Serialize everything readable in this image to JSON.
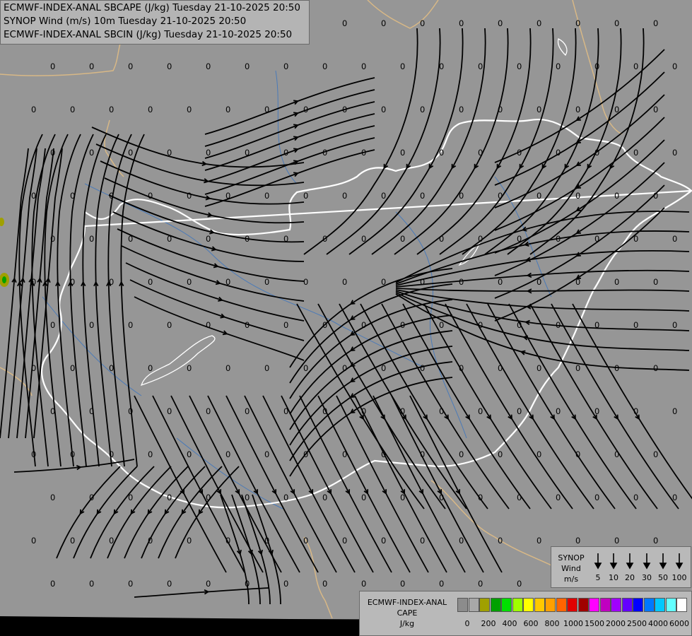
{
  "titles": {
    "line1": "ECMWF-INDEX-ANAL SBCAPE (J/kg) Tuesday 21-10-2025 20:50",
    "line2": "SYNOP Wind (m/s) 10m Tuesday 21-10-2025 20:50",
    "line3": "ECMWF-INDEX-ANAL SBCIN (J/kg) Tuesday 21-10-2025 20:50"
  },
  "synop_legend": {
    "title": "SYNOP",
    "subtitle": "Wind",
    "unit": "m/s",
    "speeds": [
      "5",
      "10",
      "20",
      "30",
      "50",
      "100"
    ],
    "map_label": "0"
  },
  "cape_legend": {
    "title": "ECMWF-INDEX-ANAL",
    "subtitle": "CAPE",
    "unit": "J/kg",
    "ticks": [
      "0",
      "200",
      "400",
      "600",
      "800",
      "1000",
      "1500",
      "2000",
      "2500",
      "4000",
      "6000"
    ],
    "colors": [
      "#8c8c8c",
      "#a8a8a8",
      "#a0a000",
      "#00a000",
      "#00e000",
      "#a0ff00",
      "#ffff00",
      "#ffc800",
      "#ffa000",
      "#ff6400",
      "#e00000",
      "#a00000",
      "#ff00ff",
      "#c000c0",
      "#a000ff",
      "#6400ff",
      "#0000ff",
      "#0078ff",
      "#00c8ff",
      "#64ffff",
      "#ffffff"
    ]
  }
}
